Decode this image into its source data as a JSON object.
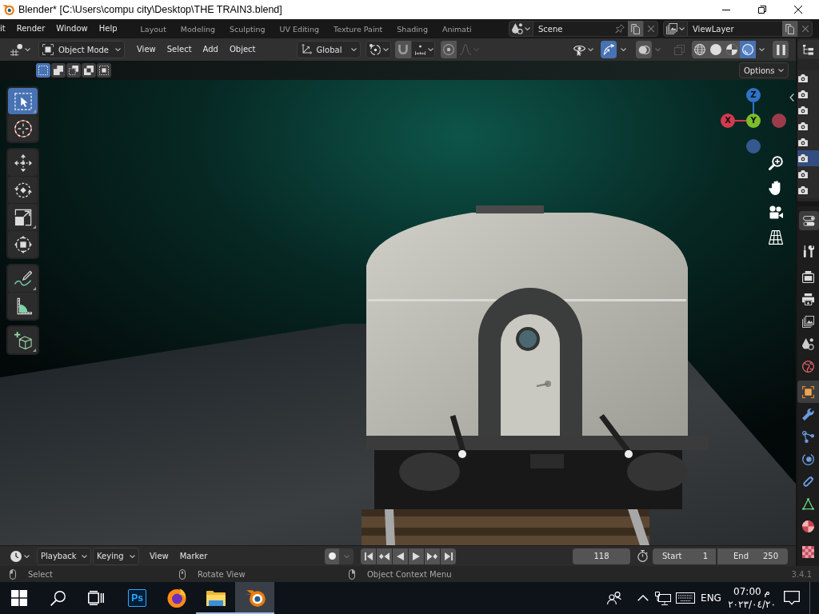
{
  "window": {
    "title": "Blender* [C:\\Users\\compu city\\Desktop\\THE TRAIN3.blend]"
  },
  "top_bar": {
    "menus": [
      "it",
      "Render",
      "Window",
      "Help"
    ],
    "workspaces": [
      {
        "label": "Layout",
        "selected": false
      },
      {
        "label": "Modeling",
        "selected": false
      },
      {
        "label": "Sculpting",
        "selected": false
      },
      {
        "label": "UV Editing",
        "selected": false
      },
      {
        "label": "Texture Paint",
        "selected": false
      },
      {
        "label": "Shading",
        "selected": false
      },
      {
        "label": "Animati",
        "selected": false
      }
    ],
    "scene": "Scene",
    "view_layer": "ViewLayer"
  },
  "viewport_header": {
    "mode": "Object Mode",
    "menus": [
      "View",
      "Select",
      "Add",
      "Object"
    ],
    "orientation": "Global",
    "snap": {
      "on": false
    },
    "proportional_editing": {
      "on": false
    },
    "gizmos": {
      "on": true
    },
    "overlays": {
      "on": false
    },
    "xray": {
      "disabled": true
    },
    "shading": [
      {
        "kind": "wireframe",
        "selected": false
      },
      {
        "kind": "solid",
        "selected": false
      },
      {
        "kind": "material",
        "selected": false
      },
      {
        "kind": "rendered",
        "selected": true
      }
    ]
  },
  "tool_settings": {
    "select_modes": [
      {
        "kind": "set",
        "selected": true
      },
      {
        "kind": "extend",
        "selected": false
      },
      {
        "kind": "subtract",
        "selected": false
      },
      {
        "kind": "difference",
        "selected": false
      },
      {
        "kind": "intersect",
        "selected": false
      }
    ],
    "options": "Options"
  },
  "toolbar": {
    "groups": [
      {
        "tools": [
          {
            "kind": "select",
            "selected": true
          },
          {
            "kind": "cursor",
            "selected": false
          }
        ]
      },
      {
        "tools": [
          {
            "kind": "move",
            "selected": false
          },
          {
            "kind": "rotate",
            "selected": false
          },
          {
            "kind": "scale",
            "selected": false
          },
          {
            "kind": "transform",
            "selected": false
          }
        ]
      },
      {
        "tools": [
          {
            "kind": "annotate",
            "selected": false
          },
          {
            "kind": "measure",
            "selected": false
          }
        ]
      },
      {
        "tools": [
          {
            "kind": "add",
            "selected": false
          }
        ]
      }
    ]
  },
  "navigation_gizmo": {
    "axes": [
      {
        "kind": "z",
        "label": "Z",
        "color": "#2f72c8"
      },
      {
        "kind": "x",
        "label": "X",
        "color": "#d43a4e"
      },
      {
        "kind": "y",
        "label": "Y",
        "color": "#7cbd2c"
      },
      {
        "kind": "negx",
        "color": "#9c3c4a"
      },
      {
        "kind": "negz",
        "color": "#34598f"
      }
    ]
  },
  "outliner": {
    "rows": [
      {
        "selected": false
      },
      {
        "selected": false
      },
      {
        "selected": false
      },
      {
        "selected": false
      },
      {
        "selected": false
      },
      {
        "selected": true
      },
      {
        "selected": false
      },
      {
        "selected": false
      }
    ]
  },
  "properties": {
    "tab_groups": [
      {
        "tabs": [
          {
            "kind": "tool",
            "selected": false
          }
        ]
      },
      {
        "tabs": [
          {
            "kind": "render",
            "selected": false
          },
          {
            "kind": "output",
            "selected": false
          },
          {
            "kind": "viewlayer",
            "selected": false
          },
          {
            "kind": "scene",
            "selected": false
          },
          {
            "kind": "world",
            "selected": false
          }
        ]
      },
      {
        "tabs": [
          {
            "kind": "object",
            "selected": true
          },
          {
            "kind": "modifiers",
            "selected": false
          },
          {
            "kind": "particles",
            "selected": false
          },
          {
            "kind": "physics",
            "selected": false
          },
          {
            "kind": "constraints",
            "selected": false
          },
          {
            "kind": "data",
            "selected": false
          },
          {
            "kind": "material",
            "selected": false
          }
        ]
      },
      {
        "tabs": [
          {
            "kind": "texture",
            "selected": false
          }
        ]
      }
    ]
  },
  "timeline": {
    "dropdowns": [
      "Playback",
      "Keying"
    ],
    "menus": [
      "View",
      "Marker"
    ],
    "auto_keying": {
      "on": false
    },
    "current_frame": "118",
    "start": {
      "label": "Start",
      "value": "1"
    },
    "end": {
      "label": "End",
      "value": "250"
    }
  },
  "status_bar": {
    "hints": [
      {
        "kind": "left",
        "label": "Select"
      },
      {
        "kind": "middle",
        "label": "Rotate View"
      },
      {
        "kind": "right",
        "label": "Object Context Menu"
      }
    ],
    "version": "3.4.1"
  },
  "taskbar": {
    "apps": [
      {
        "kind": "ps",
        "label": "Ps",
        "running": false,
        "selected": false
      },
      {
        "kind": "browser",
        "running": false,
        "selected": false
      },
      {
        "kind": "folder",
        "running": true,
        "selected": false
      },
      {
        "kind": "blender",
        "running": true,
        "selected": true
      }
    ],
    "language": "ENG",
    "time": "07:00 م",
    "date": "٢٠٢٣/٠٤/٢٠"
  }
}
